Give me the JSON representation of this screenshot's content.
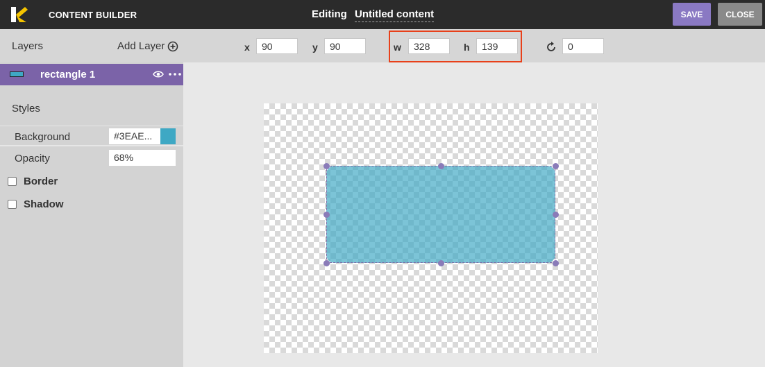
{
  "header": {
    "app_title": "CONTENT BUILDER",
    "editing_label": "Editing",
    "document_title": "Untitled content",
    "save_label": "SAVE",
    "close_label": "CLOSE"
  },
  "toolbar": {
    "x_label": "x",
    "x_value": "90",
    "y_label": "y",
    "y_value": "90",
    "w_label": "w",
    "w_value": "328",
    "h_label": "h",
    "h_value": "139",
    "rotation_icon": "rotate-icon",
    "rotation_value": "0"
  },
  "sidebar": {
    "layers_title": "Layers",
    "add_layer_label": "Add Layer",
    "layers": [
      {
        "name": "rectangle 1"
      }
    ],
    "styles_title": "Styles",
    "background_label": "Background",
    "background_value": "#3EAE...",
    "opacity_label": "Opacity",
    "opacity_value": "68%",
    "border_label": "Border",
    "shadow_label": "Shadow"
  },
  "colors": {
    "accent": "#7b63a8",
    "shape_fill": "#3ea8c4",
    "highlight": "#e8401a",
    "topbar": "#2b2b2b"
  }
}
